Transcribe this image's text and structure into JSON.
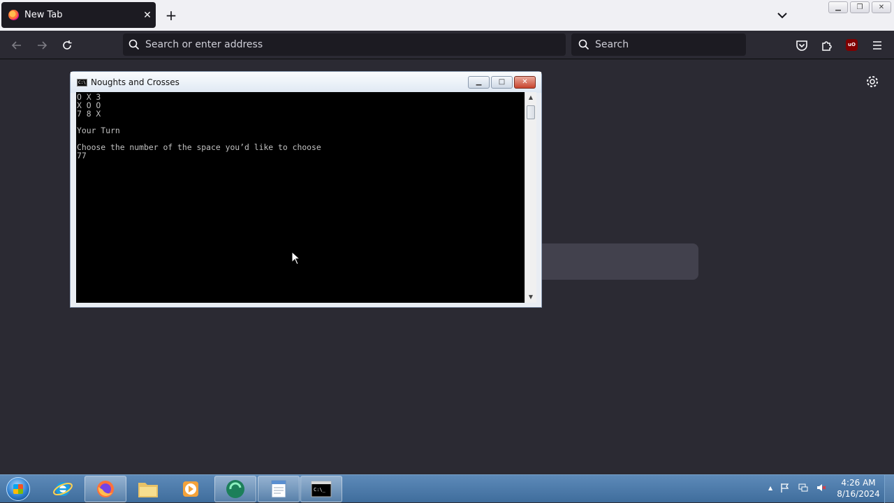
{
  "browser": {
    "tab": {
      "title": "New Tab",
      "close": "✕"
    },
    "new_tab": "+",
    "address": {
      "placeholder": "Search or enter address"
    },
    "search": {
      "placeholder": "Search"
    },
    "ublock_label": "uO"
  },
  "console": {
    "title": "Noughts and Crosses",
    "buttons": {
      "minimize": "▁",
      "maximize": "□",
      "close": "✕"
    },
    "output": "O X 3\nX O O\n7 8 X\n\nYour Turn\n\nChoose the number of the space you’d like to choose\n77",
    "scroll": {
      "up": "▲",
      "down": "▼"
    }
  },
  "taskbar": {
    "clock": {
      "time": "4:26 AM",
      "date": "8/16/2024"
    },
    "tray": {
      "arrow": "▲"
    }
  },
  "colors": {
    "accent": "#2b2a33",
    "console_bg": "#000000",
    "taskbar": "#4a7aa8"
  }
}
